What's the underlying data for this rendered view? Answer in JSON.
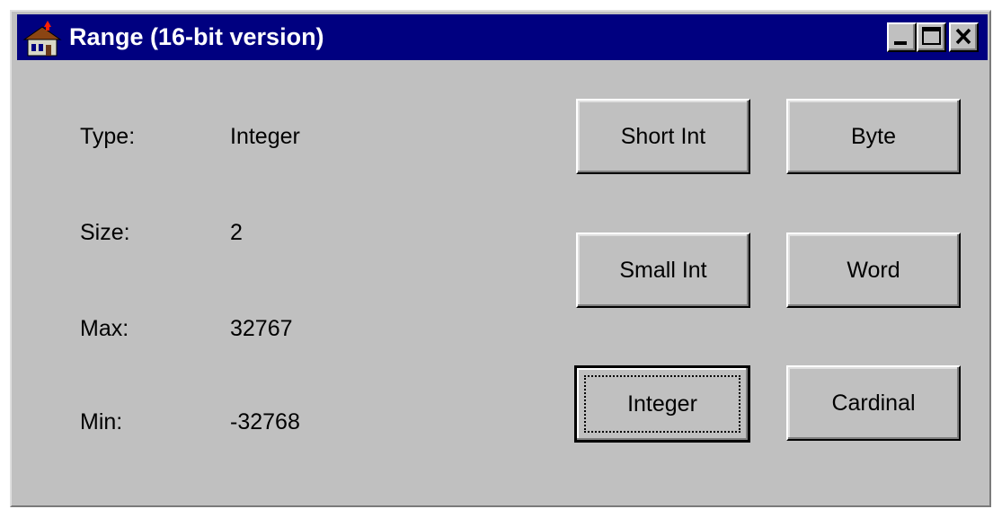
{
  "window": {
    "title": "Range (16-bit version)",
    "icon": "app-house-icon",
    "controls": [
      "minimize-icon",
      "maximize-icon",
      "close-icon"
    ]
  },
  "info": {
    "type_label": "Type:",
    "type_value": "Integer",
    "size_label": "Size:",
    "size_value": "2",
    "max_label": "Max:",
    "max_value": "32767",
    "min_label": "Min:",
    "min_value": "-32768"
  },
  "buttons": {
    "short_int": "Short Int",
    "byte": "Byte",
    "small_int": "Small Int",
    "word": "Word",
    "integer": "Integer",
    "cardinal": "Cardinal"
  },
  "colors": {
    "titlebar": "#000080",
    "face": "#c0c0c0",
    "title_text": "#ffffff"
  }
}
